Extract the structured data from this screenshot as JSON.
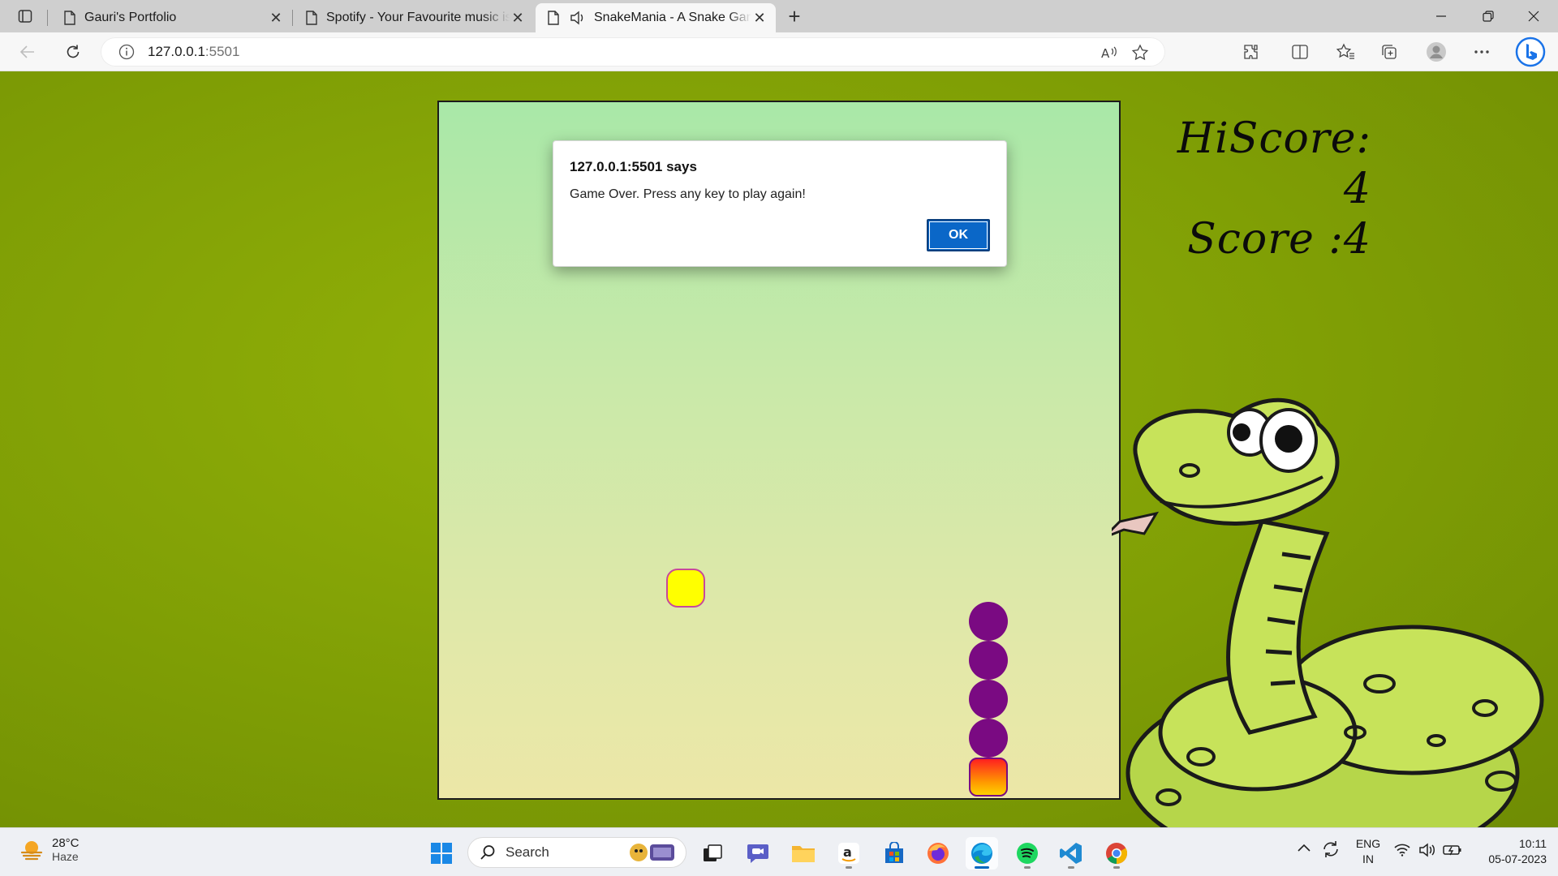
{
  "browser": {
    "tabs": [
      {
        "title": "Gauri's Portfolio",
        "active": false
      },
      {
        "title": "Spotify - Your Favourite music is here",
        "active": false
      },
      {
        "title": "SnakeMania - A Snake Game",
        "active": true
      }
    ],
    "address": {
      "host": "127.0.0.1",
      "port": ":5501"
    }
  },
  "game": {
    "hiscore_label": "HiScore: 4",
    "score_label": "Score :4",
    "snake_segments": 4
  },
  "dialog": {
    "origin": "127.0.0.1:5501 says",
    "message": "Game Over. Press any key to play again!",
    "ok_label": "OK"
  },
  "taskbar": {
    "weather": {
      "temp": "28°C",
      "condition": "Haze"
    },
    "search_label": "Search",
    "language": {
      "line1": "ENG",
      "line2": "IN"
    },
    "clock": {
      "time": "10:11",
      "date": "05-07-2023"
    }
  },
  "colors": {
    "page_bg": "#7f9e05",
    "snake_body": "#7a0a82",
    "food": "#ffff00",
    "dialog_ok": "#0a67c8"
  }
}
